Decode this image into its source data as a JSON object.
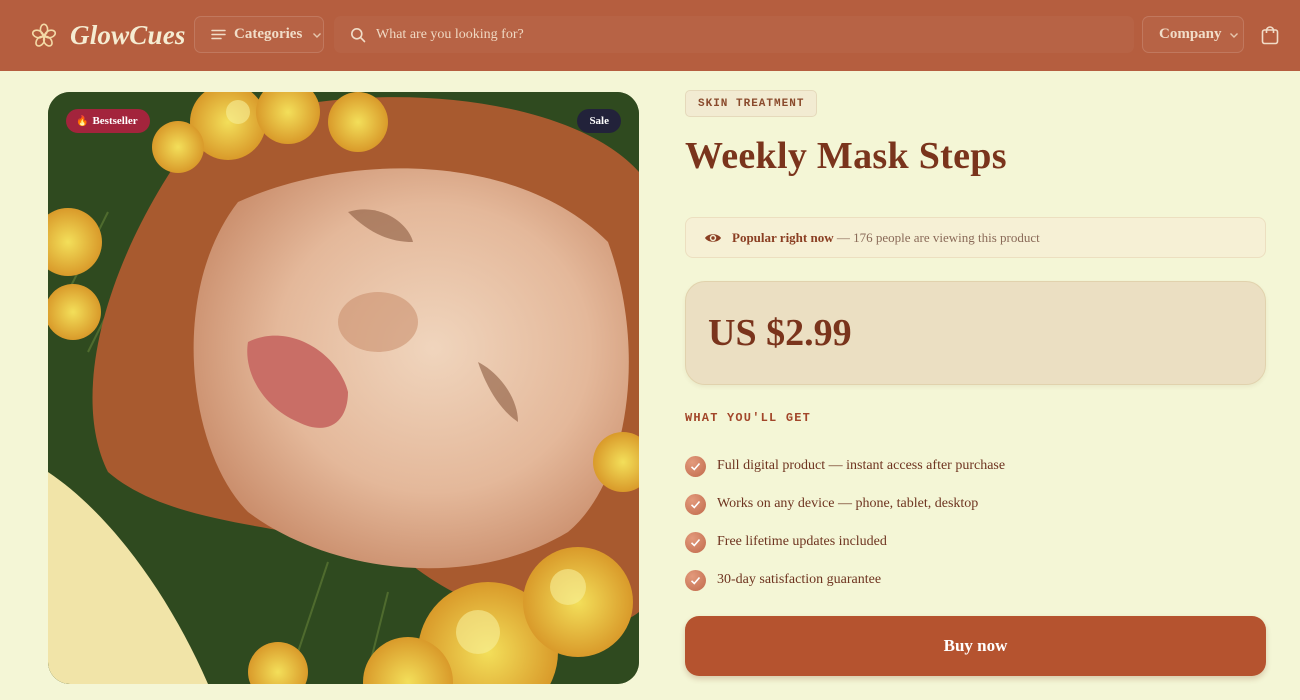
{
  "header": {
    "brand": "GlowCues",
    "categories_label": "Categories",
    "search_placeholder": "What are you looking for?",
    "company_label": "Company"
  },
  "product": {
    "badges": {
      "bestseller": "Bestseller",
      "sale": "Sale"
    },
    "tag": "SKIN TREATMENT",
    "title": "Weekly Mask Steps",
    "popular": {
      "label": "Popular right now",
      "text": "— 176 people are viewing this product"
    },
    "price": "US $2.99",
    "benefits_heading": "WHAT YOU'LL GET",
    "benefits": [
      "Full digital product — instant access after purchase",
      "Works on any device — phone, tablet, desktop",
      "Free lifetime updates included",
      "30-day satisfaction guarantee"
    ],
    "buy_label": "Buy now"
  },
  "icons": {
    "logo": "flower-icon",
    "categories": "menu-icon",
    "search": "search-icon",
    "cart": "bag-icon",
    "popular": "eye-icon",
    "benefit": "check-icon",
    "bestseller": "fire-icon"
  },
  "colors": {
    "header_bg": "#b55e3f",
    "page_bg": "#f4f6d6",
    "accent": "#b5532f",
    "bestseller_badge": "#a3243c",
    "sale_badge": "#22223a"
  }
}
